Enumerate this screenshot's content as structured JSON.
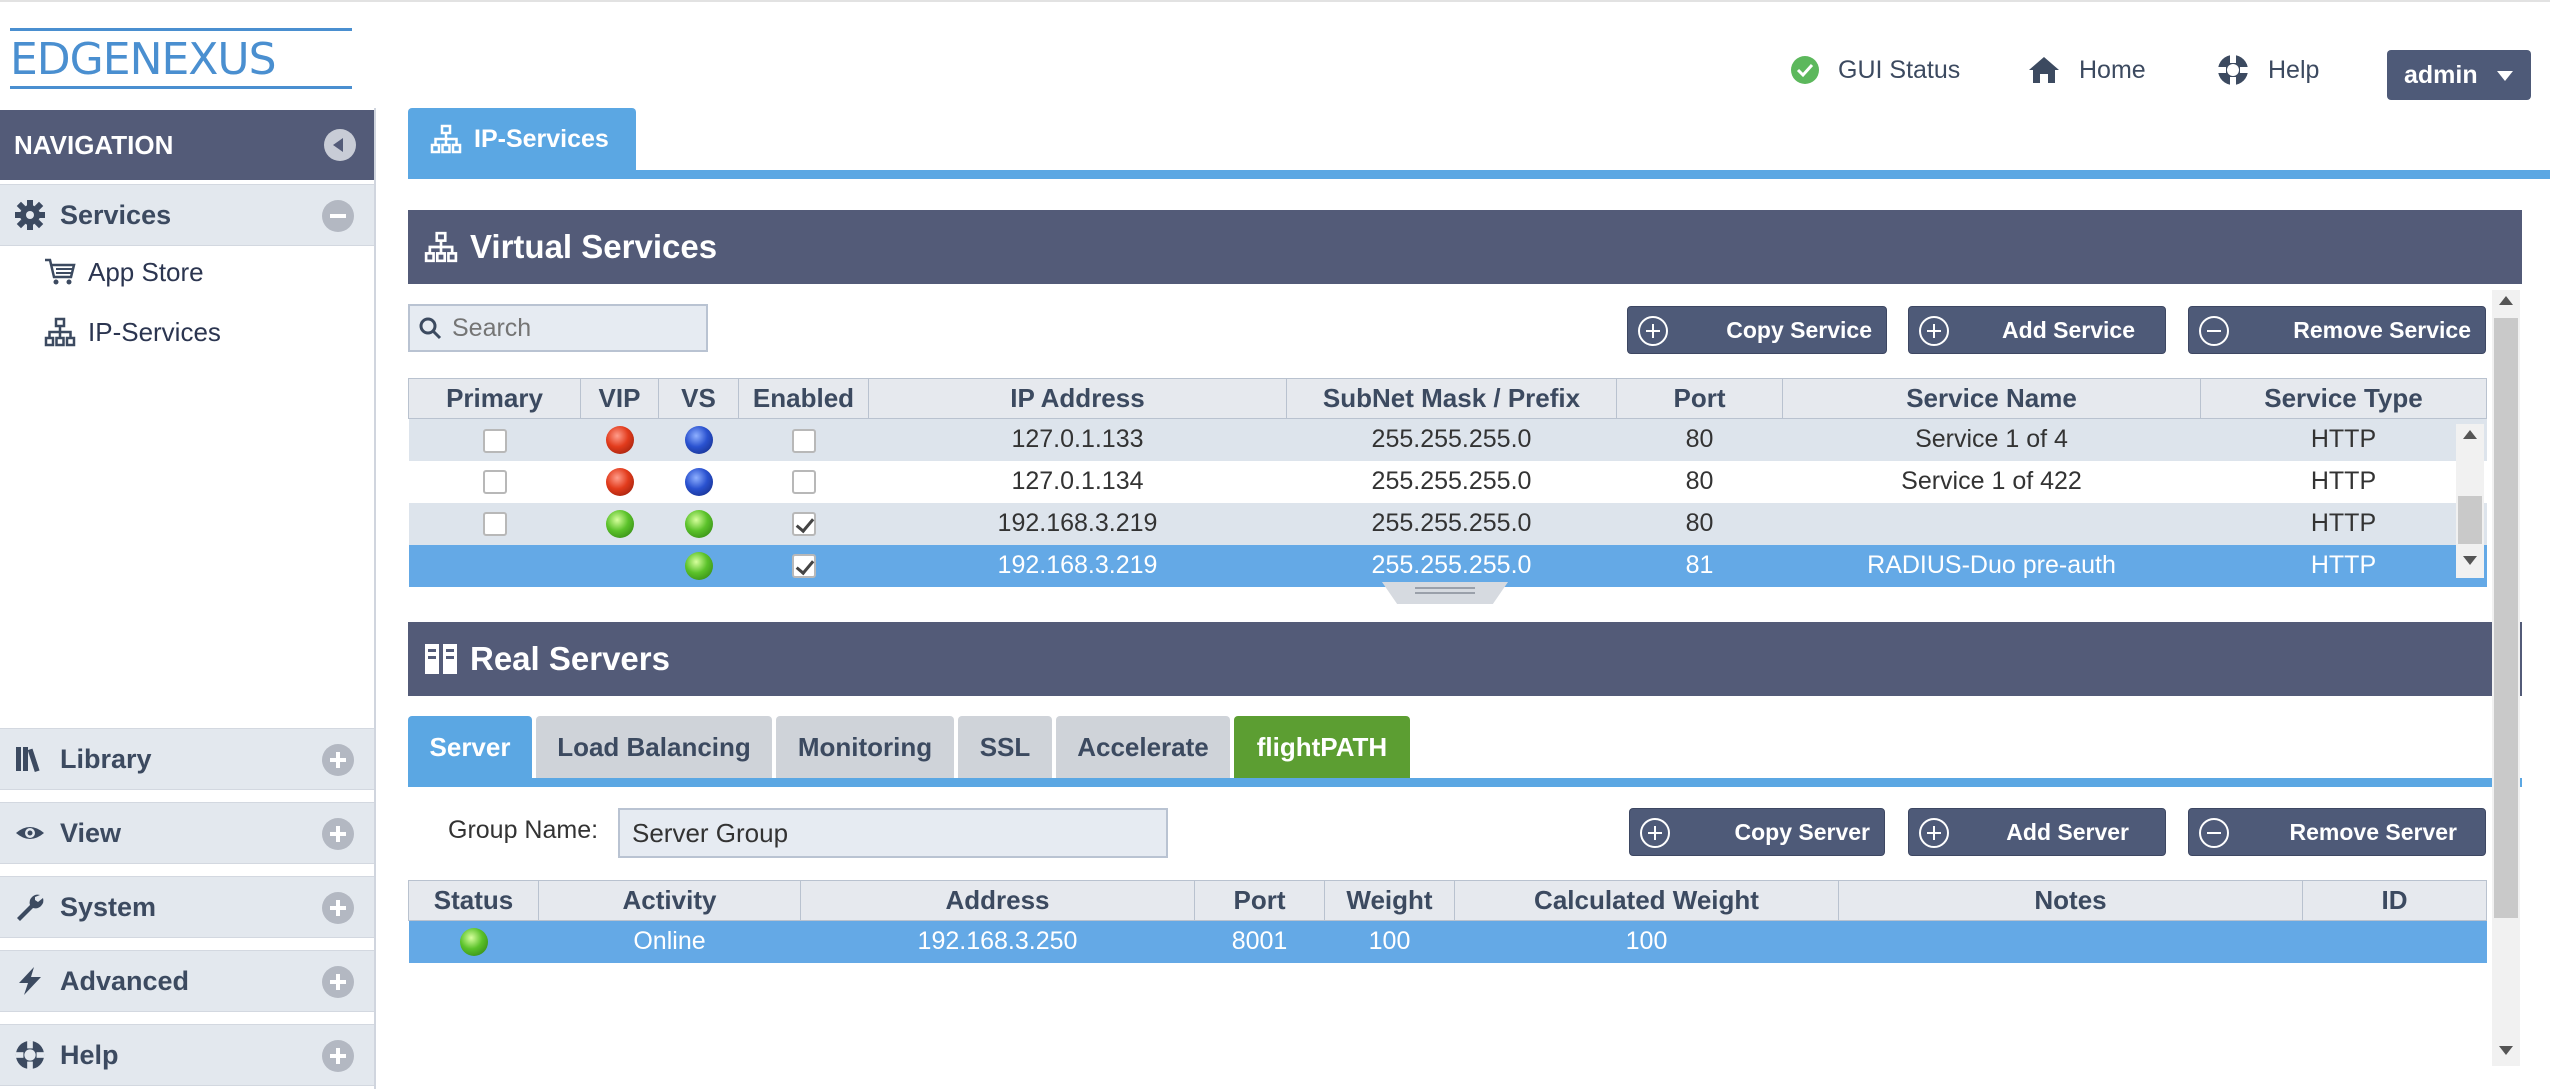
{
  "header": {
    "logo_text": "EDGENEXUS",
    "links": [
      {
        "label": "GUI Status",
        "icon": "check-circle-icon"
      },
      {
        "label": "Home",
        "icon": "home-icon"
      },
      {
        "label": "Help",
        "icon": "lifebuoy-icon"
      }
    ],
    "user": "admin"
  },
  "sidebar": {
    "title": "NAVIGATION",
    "services": {
      "label": "Services",
      "items": [
        {
          "label": "App Store",
          "icon": "cart-icon"
        },
        {
          "label": "IP-Services",
          "icon": "sitemap-icon"
        }
      ]
    },
    "sections": [
      {
        "label": "Library",
        "icon": "library-icon"
      },
      {
        "label": "View",
        "icon": "eye-icon"
      },
      {
        "label": "System",
        "icon": "wrench-icon"
      },
      {
        "label": "Advanced",
        "icon": "lightning-icon"
      },
      {
        "label": "Help",
        "icon": "lifebuoy-icon"
      }
    ]
  },
  "main": {
    "tab": "IP-Services",
    "virtual_services": {
      "title": "Virtual Services",
      "search_placeholder": "Search",
      "buttons": {
        "copy": "Copy Service",
        "add": "Add Service",
        "remove": "Remove Service"
      },
      "columns": [
        "Primary",
        "VIP",
        "VS",
        "Enabled",
        "IP Address",
        "SubNet Mask / Prefix",
        "Port",
        "Service Name",
        "Service Type"
      ],
      "rows": [
        {
          "vip": "red",
          "vs": "blue",
          "enabled": false,
          "ip": "127.0.1.133",
          "mask": "255.255.255.0",
          "port": "80",
          "name": "Service 1 of 4",
          "type": "HTTP"
        },
        {
          "vip": "red",
          "vs": "blue",
          "enabled": false,
          "ip": "127.0.1.134",
          "mask": "255.255.255.0",
          "port": "80",
          "name": "Service 1 of 422",
          "type": "HTTP"
        },
        {
          "vip": "green",
          "vs": "green",
          "enabled": true,
          "ip": "192.168.3.219",
          "mask": "255.255.255.0",
          "port": "80",
          "name": "",
          "type": "HTTP"
        },
        {
          "vip": "",
          "vs": "green",
          "enabled": true,
          "ip": "192.168.3.219",
          "mask": "255.255.255.0",
          "port": "81",
          "name": "RADIUS-Duo pre-auth",
          "type": "HTTP"
        }
      ]
    },
    "real_servers": {
      "title": "Real Servers",
      "tabs": [
        "Server",
        "Load Balancing",
        "Monitoring",
        "SSL",
        "Accelerate",
        "flightPATH"
      ],
      "group_label": "Group Name:",
      "group_value": "Server Group",
      "buttons": {
        "copy": "Copy Server",
        "add": "Add Server",
        "remove": "Remove Server"
      },
      "columns": [
        "Status",
        "Activity",
        "Address",
        "Port",
        "Weight",
        "Calculated Weight",
        "Notes",
        "ID"
      ],
      "rows": [
        {
          "status": "green",
          "activity": "Online",
          "address": "192.168.3.250",
          "port": "8001",
          "weight": "100",
          "calc_weight": "100",
          "notes": "",
          "id": ""
        }
      ]
    }
  }
}
